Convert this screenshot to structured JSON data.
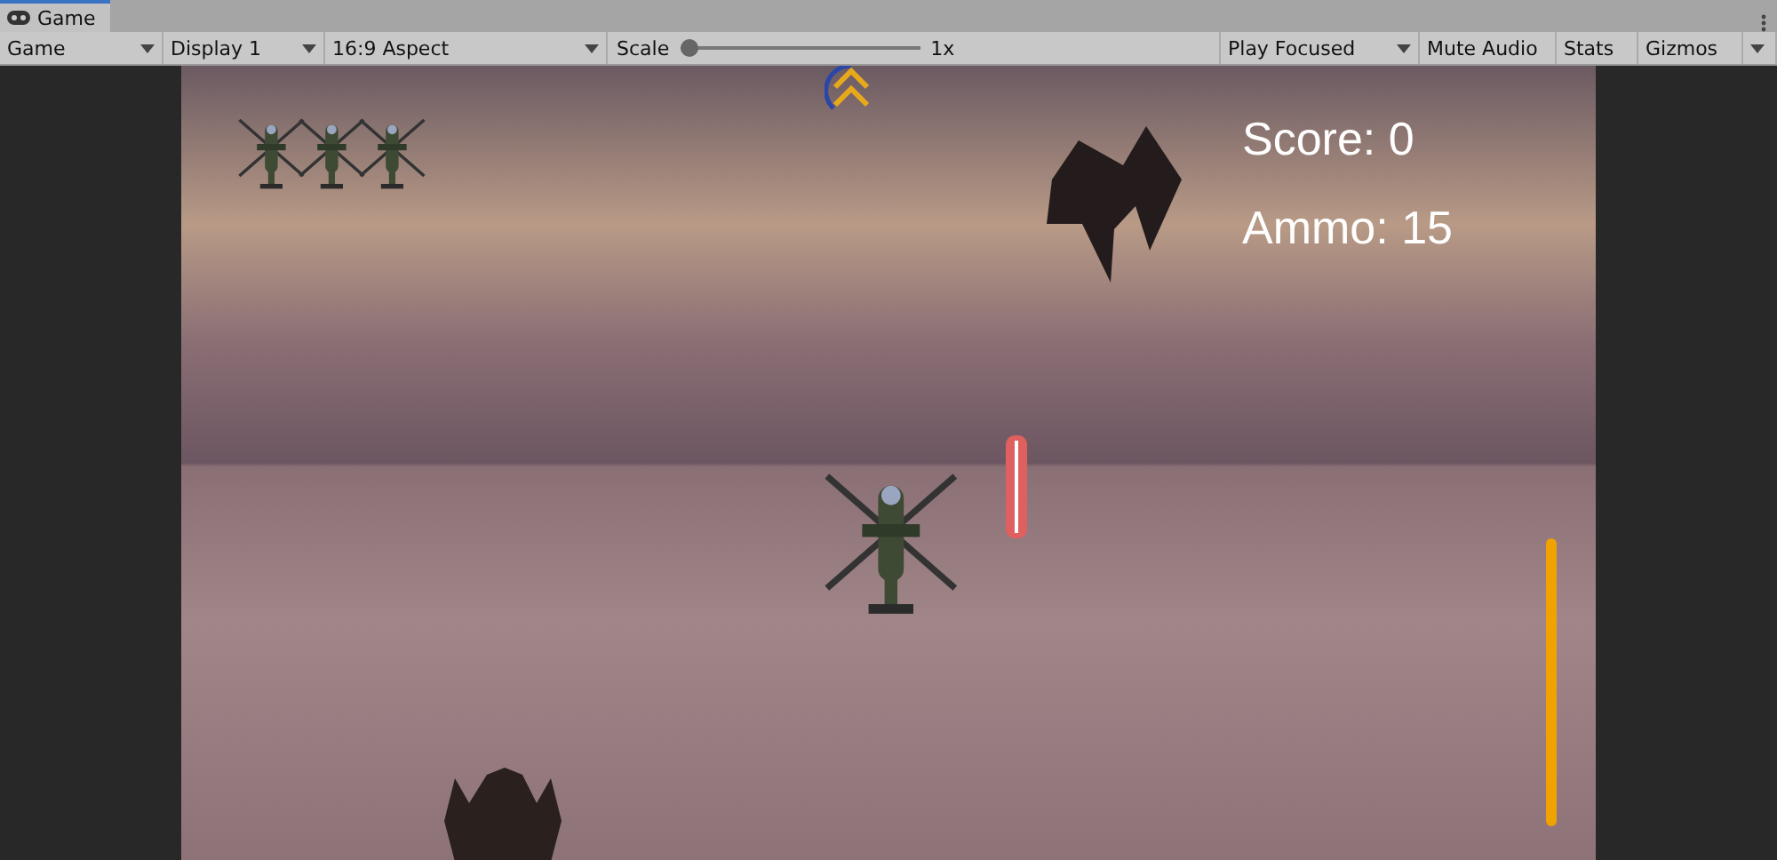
{
  "window": {
    "tab": "Game"
  },
  "toolbar": [
    {
      "kind": "dropdown",
      "label": "Game"
    },
    {
      "kind": "dropdown",
      "label": "Display 1"
    },
    {
      "kind": "dropdown",
      "label": "16:9 Aspect"
    },
    {
      "kind": "slider",
      "label": "Scale",
      "level": 0,
      "reading": "1x"
    },
    {
      "kind": "dropdown",
      "label": "Play Focused"
    },
    {
      "kind": "toggle",
      "label": "Mute Audio",
      "selected": false
    },
    {
      "kind": "toggle",
      "label": "Stats",
      "selected": false
    },
    {
      "kind": "split",
      "label": "Gizmos"
    }
  ],
  "hud": {
    "score": "Score: 0",
    "ammo": "Ammo: 15"
  }
}
